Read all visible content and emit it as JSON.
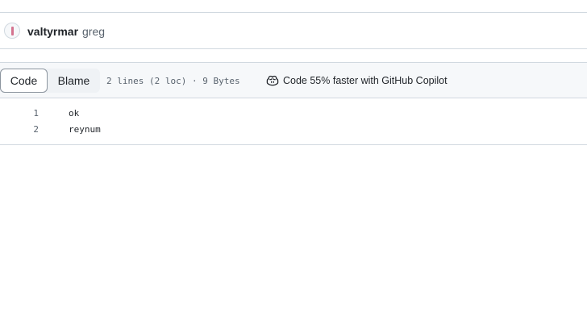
{
  "commit": {
    "author": "valtyrmar",
    "message": "greg"
  },
  "file_header": {
    "tabs": [
      {
        "label": "Code",
        "selected": true
      },
      {
        "label": "Blame",
        "selected": false
      }
    ],
    "file_info": "2 lines (2 loc) · 9 Bytes",
    "copilot_label": "Code 55% faster with GitHub Copilot"
  },
  "code": {
    "lines": [
      {
        "number": "1",
        "text": "ok"
      },
      {
        "number": "2",
        "text": "reynum"
      }
    ]
  },
  "colors": {
    "border": "#d1d9e0",
    "header_bg": "#f6f8fa",
    "muted_text": "#59636e",
    "avatar_accent": "#d4738f"
  },
  "icons": {
    "avatar": "user-avatar",
    "copilot": "copilot-icon"
  }
}
